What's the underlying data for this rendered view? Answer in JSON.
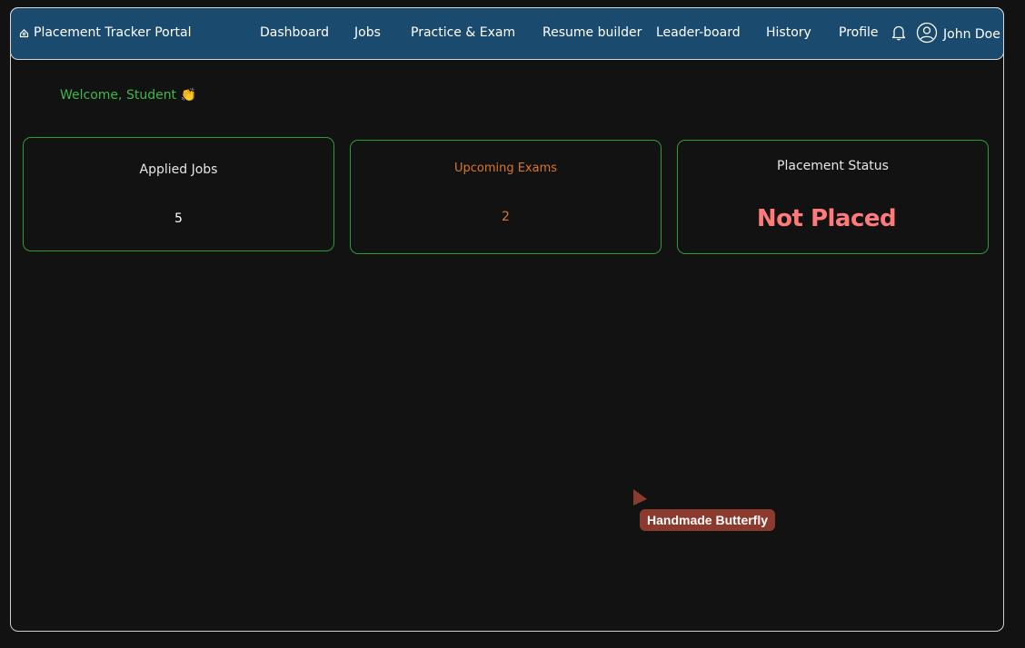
{
  "app": {
    "title": "Placement Tracker Portal"
  },
  "nav": {
    "items": [
      {
        "label": "Dashboard"
      },
      {
        "label": "Jobs"
      },
      {
        "label": "Practice & Exam"
      },
      {
        "label": "Resume builder"
      },
      {
        "label": "Leader-board"
      },
      {
        "label": "History"
      },
      {
        "label": "Profile"
      }
    ],
    "notification_icon": "bell-icon",
    "user_icon": "user-circle-icon",
    "user_name": "John Doe"
  },
  "welcome": {
    "text": "Welcome, Student",
    "emoji": "👏"
  },
  "cards": {
    "applied_jobs": {
      "title": "Applied Jobs",
      "value": "5"
    },
    "upcoming_exams": {
      "title": "Upcoming Exams",
      "value": "2"
    },
    "placement_status": {
      "title": "Placement Status",
      "value": "Not Placed"
    }
  },
  "collab_cursor": {
    "label": "Handmade Butterfly",
    "color": "#8b3a2e"
  },
  "colors": {
    "navbar": "#1a4a6e",
    "background": "#121212",
    "accent_green": "#3db84a",
    "exam_orange": "#d9772a",
    "status_red": "#ff7b7b"
  }
}
